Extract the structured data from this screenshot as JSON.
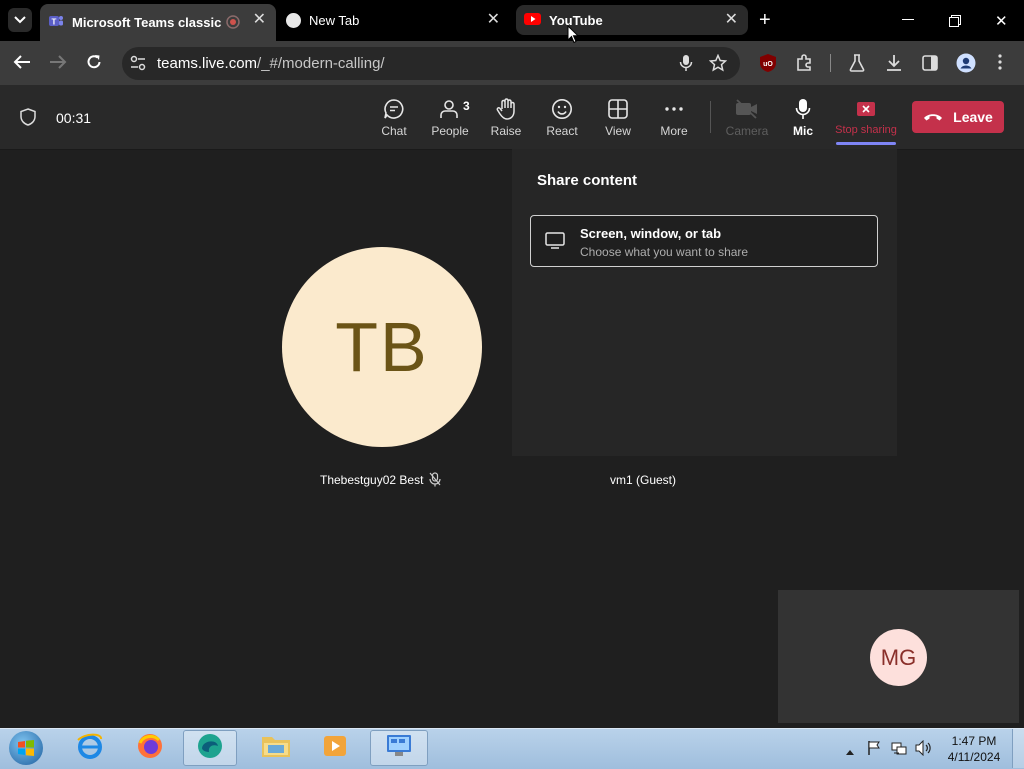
{
  "browser": {
    "tabs": [
      {
        "title": "Microsoft Teams classic",
        "active": true
      },
      {
        "title": "New Tab",
        "active": false
      },
      {
        "title": "YouTube",
        "active": false
      }
    ],
    "address": {
      "host": "teams.live.com",
      "path": "/_#/modern-calling/"
    }
  },
  "meeting": {
    "timer": "00:31",
    "buttons": {
      "chat": "Chat",
      "people": "People",
      "people_count": "3",
      "raise": "Raise",
      "react": "React",
      "view": "View",
      "more": "More",
      "camera": "Camera",
      "mic": "Mic",
      "stop_sharing": "Stop sharing",
      "leave": "Leave"
    },
    "share_panel": {
      "title": "Share content",
      "option_title": "Screen, window, or tab",
      "option_subtitle": "Choose what you want to share"
    },
    "participants": [
      {
        "initials": "TB",
        "name": "Thebestguy02 Best",
        "muted": true
      },
      {
        "name": "vm1 (Guest)"
      },
      {
        "initials": "MG"
      }
    ]
  },
  "taskbar": {
    "time": "1:47 PM",
    "date": "4/11/2024"
  },
  "colors": {
    "leave": "#c4314b",
    "accent": "#7f85f5",
    "avatar_tb_bg": "#fbeacd",
    "avatar_mg_bg": "#fde0dc"
  }
}
